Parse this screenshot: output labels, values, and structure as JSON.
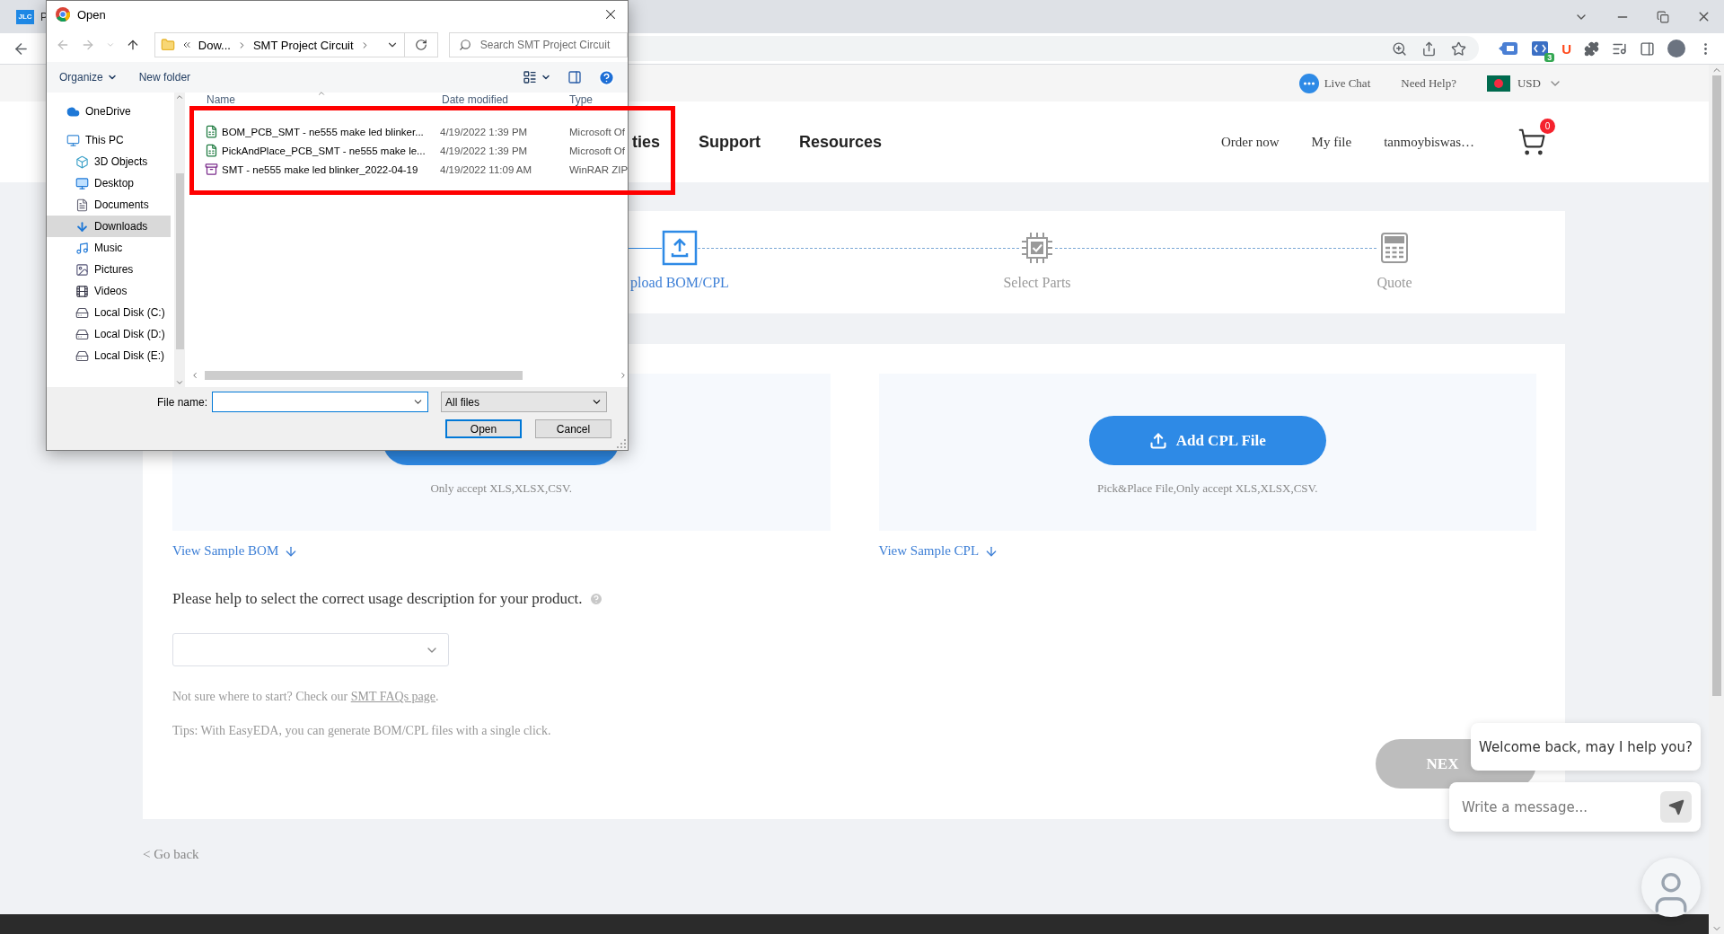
{
  "browser": {
    "tab_favicon": "JLC",
    "tab_title": "P",
    "extension_badge": "3",
    "extension_letter": "U"
  },
  "dialog": {
    "title": "Open",
    "path": [
      "Dow...",
      "SMT Project Circuit"
    ],
    "search_placeholder": "Search SMT Project Circuit",
    "toolbar": [
      "Organize",
      "New folder"
    ],
    "nav": [
      {
        "label": "OneDrive",
        "kind": "cloud",
        "selected": false
      },
      {
        "label": "This PC",
        "kind": "pc",
        "selected": false,
        "children": [
          {
            "label": "3D Objects",
            "kind": "cube",
            "selected": false
          },
          {
            "label": "Desktop",
            "kind": "desktop",
            "selected": false
          },
          {
            "label": "Documents",
            "kind": "documents",
            "selected": false
          },
          {
            "label": "Downloads",
            "kind": "downloads",
            "selected": true
          },
          {
            "label": "Music",
            "kind": "music",
            "selected": false
          },
          {
            "label": "Pictures",
            "kind": "pictures",
            "selected": false
          },
          {
            "label": "Videos",
            "kind": "videos",
            "selected": false
          },
          {
            "label": "Local Disk (C:)",
            "kind": "disk",
            "selected": false
          },
          {
            "label": "Local Disk (D:)",
            "kind": "disk",
            "selected": false
          },
          {
            "label": "Local Disk (E:)",
            "kind": "disk",
            "selected": false
          }
        ]
      }
    ],
    "columns": [
      "Name",
      "Date modified",
      "Type"
    ],
    "files": [
      {
        "name": "BOM_PCB_SMT - ne555 make led blinker...",
        "date": "4/19/2022 1:39 PM",
        "type": "Microsoft Of",
        "kind": "spreadsheet",
        "selected": false
      },
      {
        "name": "PickAndPlace_PCB_SMT - ne555 make le...",
        "date": "4/19/2022 1:39 PM",
        "type": "Microsoft Of",
        "kind": "spreadsheet",
        "selected": false
      },
      {
        "name": "SMT - ne555 make led blinker_2022-04-19",
        "date": "4/19/2022 11:09 AM",
        "type": "WinRAR ZIP",
        "kind": "archive",
        "selected": false
      }
    ],
    "file_name_label": "File name:",
    "file_type": "All files",
    "buttons": [
      "Open",
      "Cancel"
    ]
  },
  "page": {
    "top_bar": {
      "live_chat": "Live Chat",
      "help": "Need Help?",
      "currency": "USD"
    },
    "nav": {
      "items": [
        "ties",
        "Support",
        "Resources"
      ],
      "links": [
        "Order now",
        "My file"
      ],
      "user": "tanmoybiswas…",
      "cart_count": "0"
    },
    "steps": [
      {
        "label": "pload BOM/CPL",
        "kind": "upload",
        "active": true
      },
      {
        "label": "Select Parts",
        "kind": "chip",
        "active": false
      },
      {
        "label": "Quote",
        "kind": "calculator",
        "active": false
      }
    ],
    "uploads": [
      {
        "hint": "Only accept XLS,XLSX,CSV.",
        "sample_link": "View Sample BOM"
      },
      {
        "button": "Add CPL File",
        "hint": "Pick&Place File,Only accept XLS,XLSX,CSV.",
        "sample_link": "View Sample CPL"
      }
    ],
    "question": "Please help to select the correct usage description for your product.",
    "faq_before": "Not sure where to start? Check our ",
    "faq_link": "SMT FAQs page",
    "faq_after": ".",
    "tips": "Tips: With EasyEDA, you can generate BOM/CPL files with a single click.",
    "next_button": "NEX",
    "go_back": "< Go back"
  },
  "chat": {
    "greeting": "Welcome back, may I help you?",
    "placeholder": "Write a message..."
  }
}
